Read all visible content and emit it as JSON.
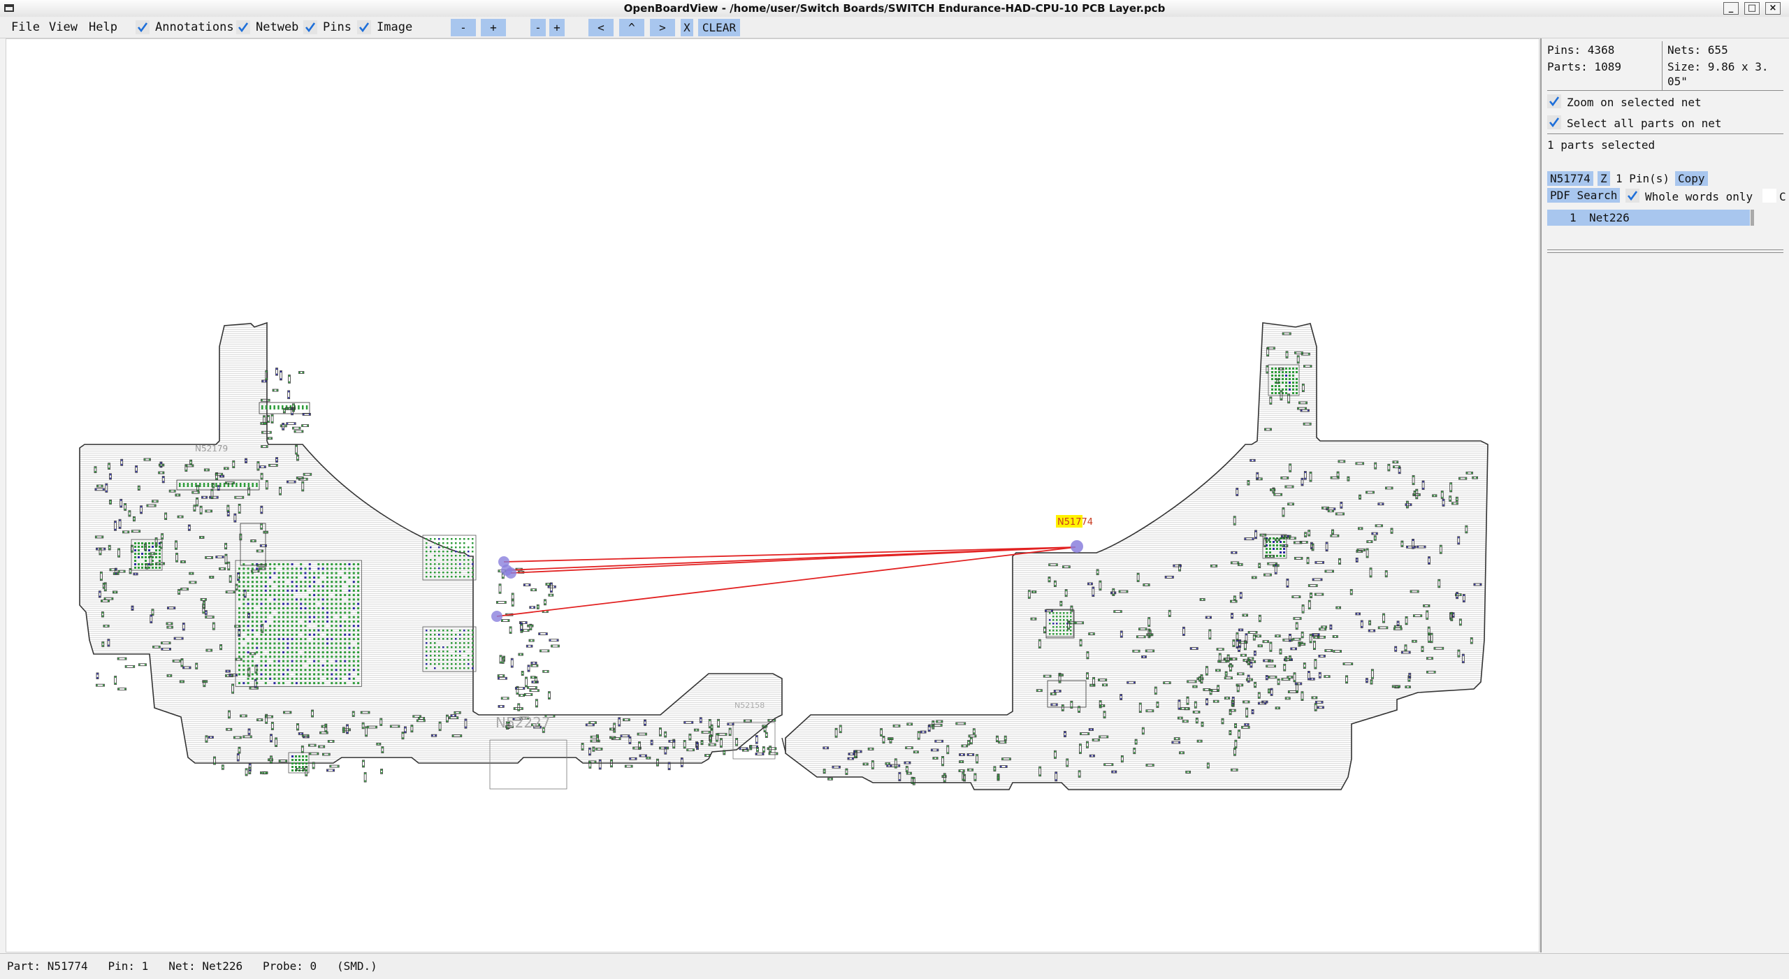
{
  "window": {
    "title": "OpenBoardView - /home/user/Switch Boards/SWITCH Endurance-HAD-CPU-10 PCB Layer.pcb",
    "buttons": {
      "minimize": "_",
      "maximize": "□",
      "close": "×"
    }
  },
  "menu": {
    "items": [
      "File",
      "View",
      "Help"
    ],
    "toggles": [
      {
        "label": "Annotations",
        "checked": true
      },
      {
        "label": "Netweb",
        "checked": true
      },
      {
        "label": "Pins",
        "checked": true
      },
      {
        "label": "Image",
        "checked": true
      }
    ],
    "zoom_out": "-",
    "zoom_in": "+",
    "shrink": "-",
    "grow": "+",
    "nav": {
      "left": "<",
      "up": "^",
      "right": ">",
      "close": "X",
      "clear": "CLEAR"
    }
  },
  "board": {
    "part_labels": [
      "N52179",
      "N52227",
      "N52158"
    ],
    "selected_part": "N51774"
  },
  "panel": {
    "pins": "Pins: 4368",
    "nets": "Nets: 655",
    "parts": "Parts: 1089",
    "size_line1": "Size: 9.86 x 3.",
    "size_line2": "05\"",
    "zoom_on_net": "Zoom on selected net",
    "select_all_on_net": "Select all parts on net",
    "parts_selected": "1 parts selected",
    "part_name": "N51774",
    "zoom_btn": "Z",
    "pin_count": "1 Pin(s)",
    "copy_btn": "Copy",
    "pdf_search": "PDF Search",
    "whole_words": "Whole words only",
    "case_cut": "C",
    "net_rows": [
      {
        "pin": "1",
        "net": "Net226"
      }
    ]
  },
  "status": {
    "text": "Part: N51774   Pin: 1   Net: Net226   Probe: 0   (SMD.)"
  },
  "colors": {
    "accent": "#a8c6ee",
    "pad_green": "#2e9c3a",
    "pad_blue": "#2a2aa0",
    "net_line": "#e22222",
    "highlight": "#fff200"
  }
}
